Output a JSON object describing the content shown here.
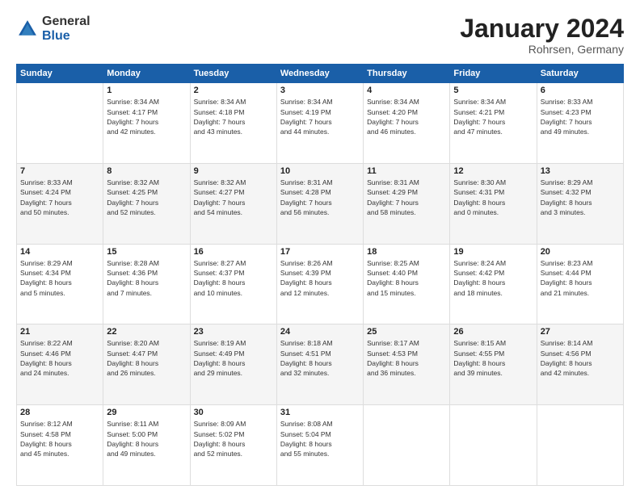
{
  "header": {
    "logo_general": "General",
    "logo_blue": "Blue",
    "month_title": "January 2024",
    "location": "Rohrsen, Germany"
  },
  "days_of_week": [
    "Sunday",
    "Monday",
    "Tuesday",
    "Wednesday",
    "Thursday",
    "Friday",
    "Saturday"
  ],
  "weeks": [
    [
      {
        "day": "",
        "info": ""
      },
      {
        "day": "1",
        "info": "Sunrise: 8:34 AM\nSunset: 4:17 PM\nDaylight: 7 hours\nand 42 minutes."
      },
      {
        "day": "2",
        "info": "Sunrise: 8:34 AM\nSunset: 4:18 PM\nDaylight: 7 hours\nand 43 minutes."
      },
      {
        "day": "3",
        "info": "Sunrise: 8:34 AM\nSunset: 4:19 PM\nDaylight: 7 hours\nand 44 minutes."
      },
      {
        "day": "4",
        "info": "Sunrise: 8:34 AM\nSunset: 4:20 PM\nDaylight: 7 hours\nand 46 minutes."
      },
      {
        "day": "5",
        "info": "Sunrise: 8:34 AM\nSunset: 4:21 PM\nDaylight: 7 hours\nand 47 minutes."
      },
      {
        "day": "6",
        "info": "Sunrise: 8:33 AM\nSunset: 4:23 PM\nDaylight: 7 hours\nand 49 minutes."
      }
    ],
    [
      {
        "day": "7",
        "info": "Sunrise: 8:33 AM\nSunset: 4:24 PM\nDaylight: 7 hours\nand 50 minutes."
      },
      {
        "day": "8",
        "info": "Sunrise: 8:32 AM\nSunset: 4:25 PM\nDaylight: 7 hours\nand 52 minutes."
      },
      {
        "day": "9",
        "info": "Sunrise: 8:32 AM\nSunset: 4:27 PM\nDaylight: 7 hours\nand 54 minutes."
      },
      {
        "day": "10",
        "info": "Sunrise: 8:31 AM\nSunset: 4:28 PM\nDaylight: 7 hours\nand 56 minutes."
      },
      {
        "day": "11",
        "info": "Sunrise: 8:31 AM\nSunset: 4:29 PM\nDaylight: 7 hours\nand 58 minutes."
      },
      {
        "day": "12",
        "info": "Sunrise: 8:30 AM\nSunset: 4:31 PM\nDaylight: 8 hours\nand 0 minutes."
      },
      {
        "day": "13",
        "info": "Sunrise: 8:29 AM\nSunset: 4:32 PM\nDaylight: 8 hours\nand 3 minutes."
      }
    ],
    [
      {
        "day": "14",
        "info": "Sunrise: 8:29 AM\nSunset: 4:34 PM\nDaylight: 8 hours\nand 5 minutes."
      },
      {
        "day": "15",
        "info": "Sunrise: 8:28 AM\nSunset: 4:36 PM\nDaylight: 8 hours\nand 7 minutes."
      },
      {
        "day": "16",
        "info": "Sunrise: 8:27 AM\nSunset: 4:37 PM\nDaylight: 8 hours\nand 10 minutes."
      },
      {
        "day": "17",
        "info": "Sunrise: 8:26 AM\nSunset: 4:39 PM\nDaylight: 8 hours\nand 12 minutes."
      },
      {
        "day": "18",
        "info": "Sunrise: 8:25 AM\nSunset: 4:40 PM\nDaylight: 8 hours\nand 15 minutes."
      },
      {
        "day": "19",
        "info": "Sunrise: 8:24 AM\nSunset: 4:42 PM\nDaylight: 8 hours\nand 18 minutes."
      },
      {
        "day": "20",
        "info": "Sunrise: 8:23 AM\nSunset: 4:44 PM\nDaylight: 8 hours\nand 21 minutes."
      }
    ],
    [
      {
        "day": "21",
        "info": "Sunrise: 8:22 AM\nSunset: 4:46 PM\nDaylight: 8 hours\nand 24 minutes."
      },
      {
        "day": "22",
        "info": "Sunrise: 8:20 AM\nSunset: 4:47 PM\nDaylight: 8 hours\nand 26 minutes."
      },
      {
        "day": "23",
        "info": "Sunrise: 8:19 AM\nSunset: 4:49 PM\nDaylight: 8 hours\nand 29 minutes."
      },
      {
        "day": "24",
        "info": "Sunrise: 8:18 AM\nSunset: 4:51 PM\nDaylight: 8 hours\nand 32 minutes."
      },
      {
        "day": "25",
        "info": "Sunrise: 8:17 AM\nSunset: 4:53 PM\nDaylight: 8 hours\nand 36 minutes."
      },
      {
        "day": "26",
        "info": "Sunrise: 8:15 AM\nSunset: 4:55 PM\nDaylight: 8 hours\nand 39 minutes."
      },
      {
        "day": "27",
        "info": "Sunrise: 8:14 AM\nSunset: 4:56 PM\nDaylight: 8 hours\nand 42 minutes."
      }
    ],
    [
      {
        "day": "28",
        "info": "Sunrise: 8:12 AM\nSunset: 4:58 PM\nDaylight: 8 hours\nand 45 minutes."
      },
      {
        "day": "29",
        "info": "Sunrise: 8:11 AM\nSunset: 5:00 PM\nDaylight: 8 hours\nand 49 minutes."
      },
      {
        "day": "30",
        "info": "Sunrise: 8:09 AM\nSunset: 5:02 PM\nDaylight: 8 hours\nand 52 minutes."
      },
      {
        "day": "31",
        "info": "Sunrise: 8:08 AM\nSunset: 5:04 PM\nDaylight: 8 hours\nand 55 minutes."
      },
      {
        "day": "",
        "info": ""
      },
      {
        "day": "",
        "info": ""
      },
      {
        "day": "",
        "info": ""
      }
    ]
  ]
}
